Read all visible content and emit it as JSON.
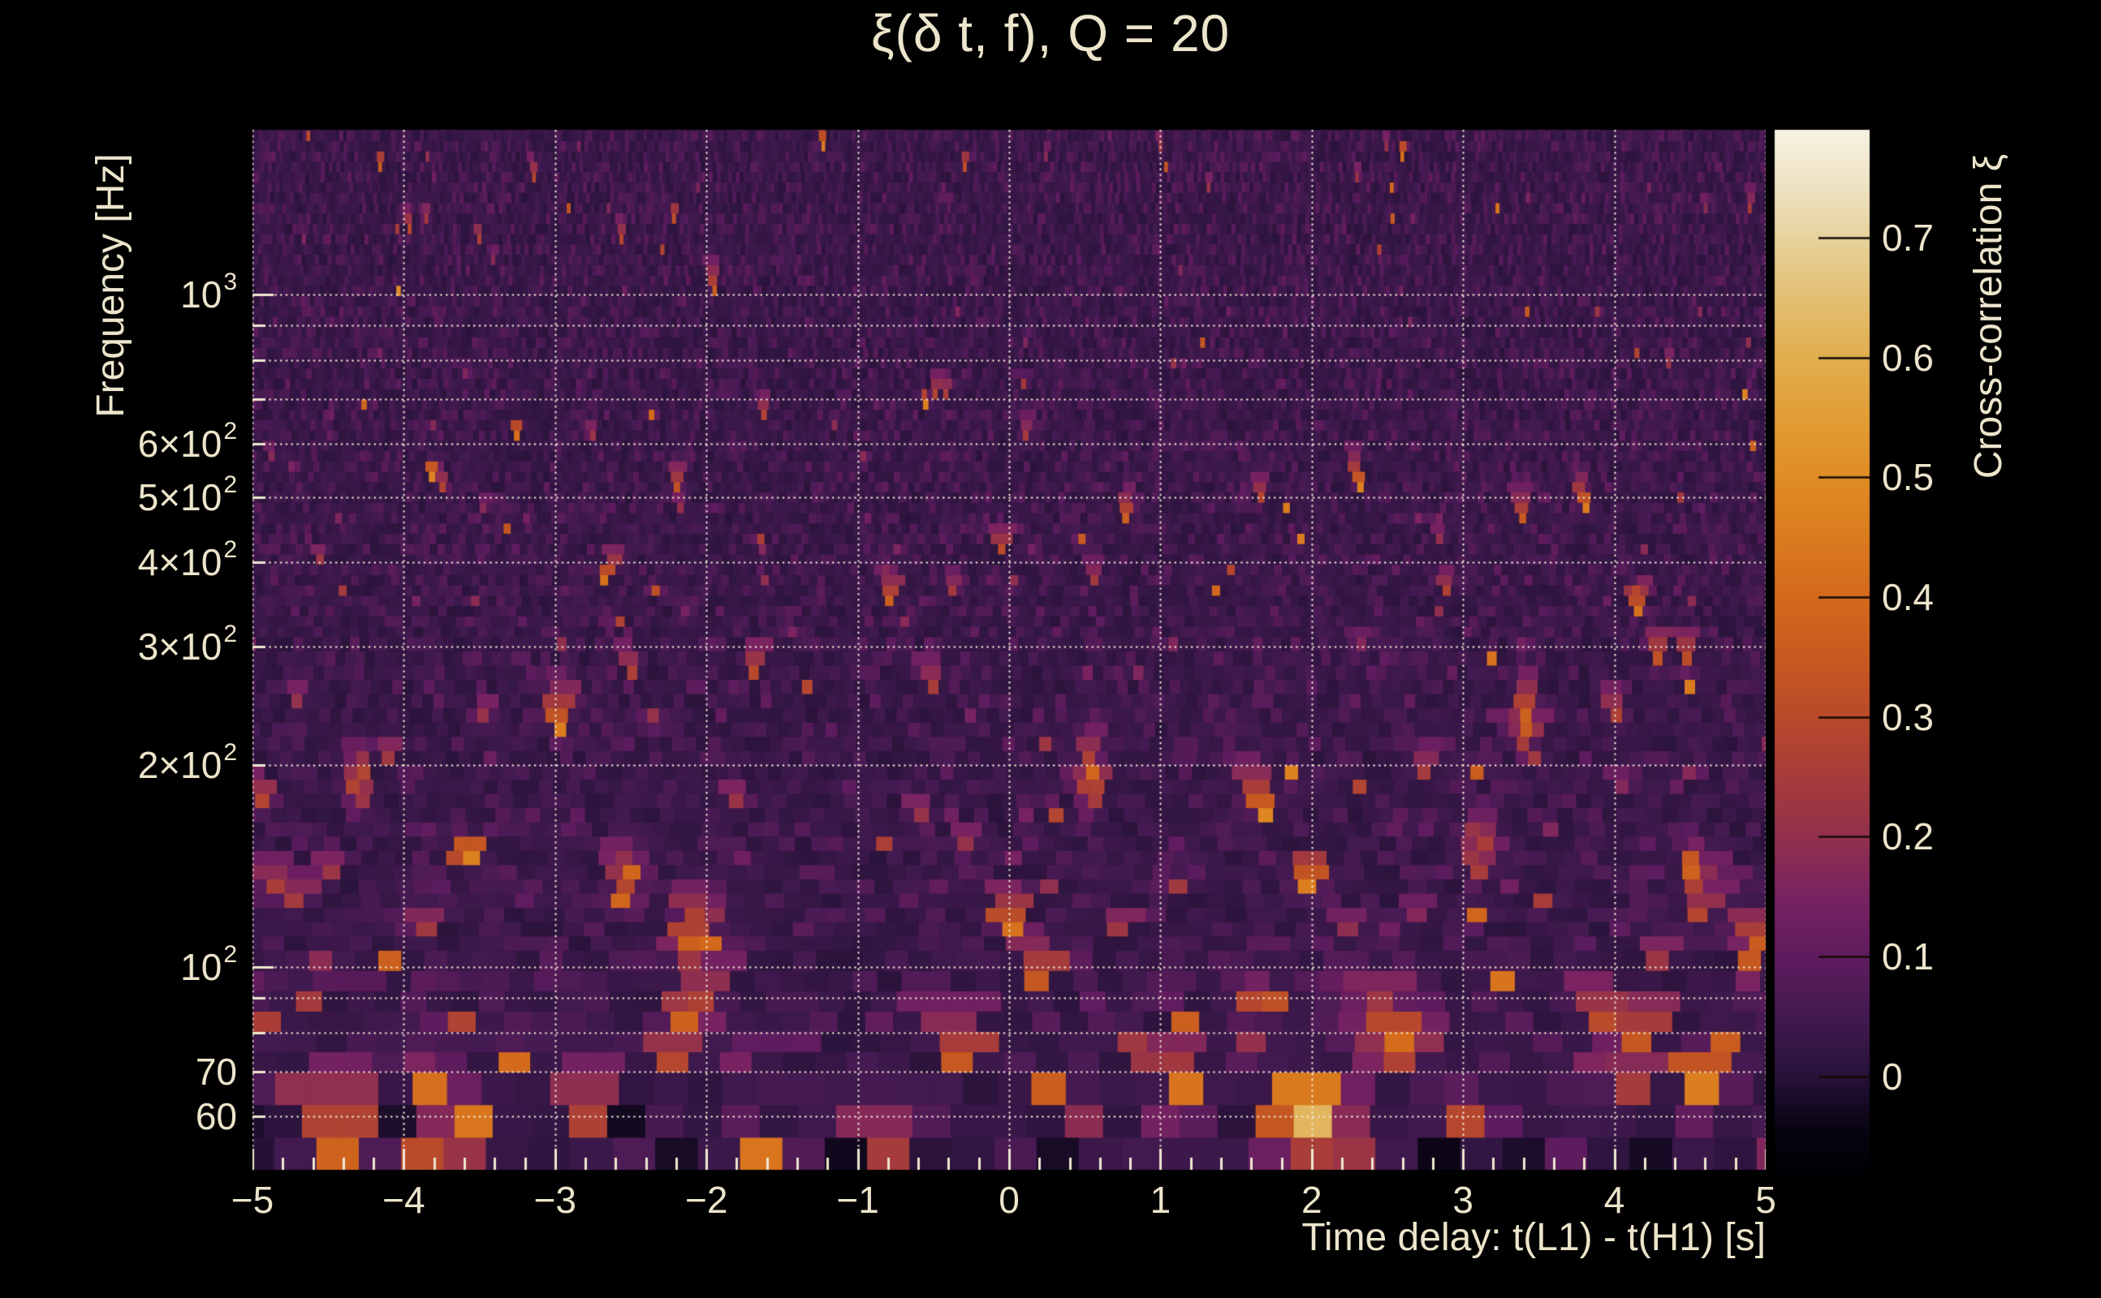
{
  "colors": {
    "background": "#000000",
    "text": "#ece5cb",
    "grid": "#f2ecda",
    "tick": "#efe8d0",
    "colorbar_tick": "#140a06"
  },
  "chart_data": {
    "type": "heatmap",
    "title": "ξ(δ t, f), Q = 20",
    "xlabel": "Time delay: t(L1) - t(H1) [s]",
    "ylabel": "Frequency [Hz]",
    "xlim": [
      -5,
      5
    ],
    "ylim_hz": [
      50,
      1758
    ],
    "x_ticks": [
      {
        "v": -5,
        "label": "−5"
      },
      {
        "v": -4,
        "label": "−4"
      },
      {
        "v": -3,
        "label": "−3"
      },
      {
        "v": -2,
        "label": "−2"
      },
      {
        "v": -1,
        "label": "−1"
      },
      {
        "v": 0,
        "label": "0"
      },
      {
        "v": 1,
        "label": "1"
      },
      {
        "v": 2,
        "label": "2"
      },
      {
        "v": 3,
        "label": "3"
      },
      {
        "v": 4,
        "label": "4"
      },
      {
        "v": 5,
        "label": "5"
      }
    ],
    "x_minor_step": 0.2,
    "y_ticks": [
      {
        "v": 1000,
        "m": "10",
        "e": "3"
      },
      {
        "v": 600,
        "m": "6×10",
        "e": "2"
      },
      {
        "v": 500,
        "m": "5×10",
        "e": "2"
      },
      {
        "v": 400,
        "m": "4×10",
        "e": "2"
      },
      {
        "v": 300,
        "m": "3×10",
        "e": "2"
      },
      {
        "v": 200,
        "m": "2×10",
        "e": "2"
      },
      {
        "v": 100,
        "m": "10",
        "e": "2"
      },
      {
        "v": 70,
        "m": "70",
        "e": ""
      },
      {
        "v": 60,
        "m": "60",
        "e": ""
      }
    ],
    "grid_x": [
      -5,
      -4,
      -3,
      -2,
      -1,
      0,
      1,
      2,
      3,
      4,
      5
    ],
    "grid_y_hz": [
      60,
      70,
      80,
      90,
      100,
      200,
      300,
      400,
      500,
      600,
      700,
      800,
      900,
      1000
    ],
    "colorbar": {
      "label": "Cross-correlation ξ",
      "vmin": -0.08,
      "vmax": 0.79,
      "ticks": [
        {
          "v": 0.0,
          "label": "0"
        },
        {
          "v": 0.1,
          "label": "0.1"
        },
        {
          "v": 0.2,
          "label": "0.2"
        },
        {
          "v": 0.3,
          "label": "0.3"
        },
        {
          "v": 0.4,
          "label": "0.4"
        },
        {
          "v": 0.5,
          "label": "0.5"
        },
        {
          "v": 0.6,
          "label": "0.6"
        },
        {
          "v": 0.7,
          "label": "0.7"
        }
      ]
    },
    "colormap_stops": [
      [
        -0.08,
        "#000004"
      ],
      [
        -0.045,
        "#070310"
      ],
      [
        0.0,
        "#261238"
      ],
      [
        0.05,
        "#421a50"
      ],
      [
        0.1,
        "#5f1c5e"
      ],
      [
        0.15,
        "#782262"
      ],
      [
        0.2,
        "#92304e"
      ],
      [
        0.25,
        "#a73c3a"
      ],
      [
        0.3,
        "#b94a2b"
      ],
      [
        0.35,
        "#c75a20"
      ],
      [
        0.4,
        "#d3691c"
      ],
      [
        0.45,
        "#da7b1e"
      ],
      [
        0.5,
        "#e08c24"
      ],
      [
        0.55,
        "#e19d35"
      ],
      [
        0.6,
        "#e1ae4e"
      ],
      [
        0.65,
        "#e3bf72"
      ],
      [
        0.7,
        "#e6d29c"
      ],
      [
        0.745,
        "#eee3c4"
      ],
      [
        0.79,
        "#f6f1e3"
      ]
    ],
    "hotspots": [
      {
        "t": 2.05,
        "f": 60,
        "v": 0.79,
        "wt": 0.09,
        "sl": 0.06
      },
      {
        "t": 2.07,
        "f": 51,
        "v": 0.55
      },
      {
        "t": -3.78,
        "f": 52,
        "v": 0.6,
        "wt": 0.12
      },
      {
        "t": -4.62,
        "f": 66,
        "v": 0.52
      },
      {
        "t": -3.85,
        "f": 66,
        "v": 0.46
      },
      {
        "t": -2.02,
        "f": 97,
        "v": 0.52,
        "wt": 0.05
      },
      {
        "t": -2.1,
        "f": 112,
        "v": 0.42
      },
      {
        "t": -2.15,
        "f": 88,
        "v": 0.48
      },
      {
        "t": 1.13,
        "f": 80,
        "v": 0.52
      },
      {
        "t": 0.85,
        "f": 72,
        "v": 0.45
      },
      {
        "t": 1.33,
        "f": 55,
        "v": 0.5
      },
      {
        "t": 4.12,
        "f": 73,
        "v": 0.52
      },
      {
        "t": 4.58,
        "f": 66,
        "v": 0.46
      },
      {
        "t": 4.93,
        "f": 105,
        "v": 0.48
      },
      {
        "t": 0.54,
        "f": 190,
        "v": 0.42
      },
      {
        "t": 3.4,
        "f": 233,
        "v": 0.4
      },
      {
        "t": -2.5,
        "f": 137,
        "v": 0.4
      },
      {
        "t": 2.6,
        "f": 78,
        "v": 0.45
      },
      {
        "t": 3.0,
        "f": 55,
        "v": 0.45
      },
      {
        "t": -0.85,
        "f": 53,
        "v": 0.42
      },
      {
        "t": 1.62,
        "f": 85,
        "v": 0.42
      },
      {
        "t": -4.3,
        "f": 190,
        "v": 0.38
      },
      {
        "t": 2.2,
        "f": 90,
        "v": 0.44
      },
      {
        "t": 3.1,
        "f": 150,
        "v": 0.4
      },
      {
        "t": 4.5,
        "f": 140,
        "v": 0.38
      }
    ],
    "texture": {
      "seed": 1270
    }
  }
}
